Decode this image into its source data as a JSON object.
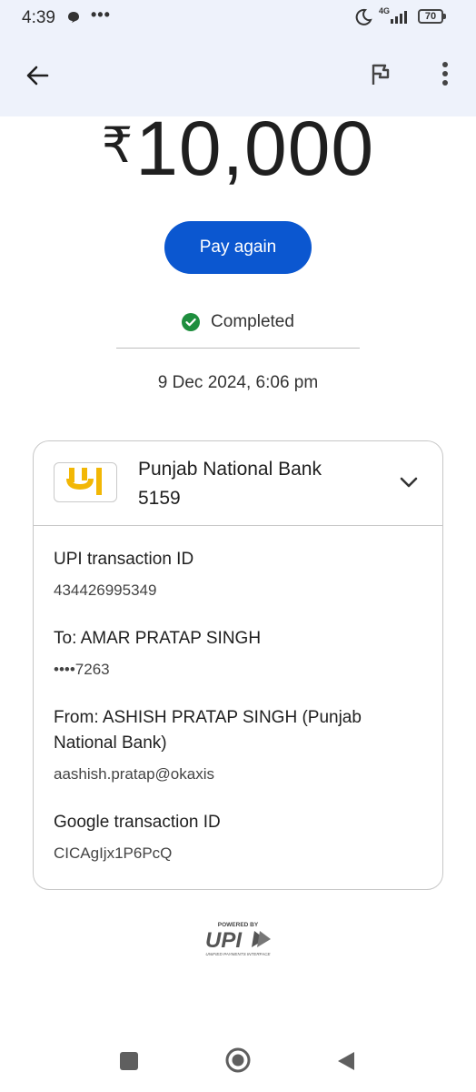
{
  "status_bar": {
    "time": "4:39",
    "network": "4G",
    "battery": "70",
    "dots": "•••"
  },
  "app_bar": {
    "back_icon": "arrow-left-icon",
    "flag_icon": "flag-icon",
    "more_icon": "more-vert-icon"
  },
  "payment": {
    "currency_symbol": "₹",
    "amount": "10,000",
    "pay_again_label": "Pay again",
    "status": "Completed",
    "status_color": "#1e8e3e",
    "datetime": "9 Dec 2024, 6:06 pm"
  },
  "bank": {
    "name": "Punjab National Bank",
    "account": "5159",
    "logo_color": "#f2b705"
  },
  "details": {
    "upi_label": "UPI transaction ID",
    "upi_value": "434426995349",
    "to_label": "To: AMAR PRATAP SINGH",
    "to_value": "••••7263",
    "from_label": "From: ASHISH PRATAP SINGH (Punjab National Bank)",
    "from_value": "aashish.pratap@okaxis",
    "google_label": "Google transaction ID",
    "google_value": "CICAgIjx1P6PcQ"
  },
  "footer": {
    "powered_by": "POWERED BY",
    "upi": "UPI",
    "upi_sub": "UNIFIED PAYMENTS INTERFACE"
  },
  "accent": "#0b57d0"
}
